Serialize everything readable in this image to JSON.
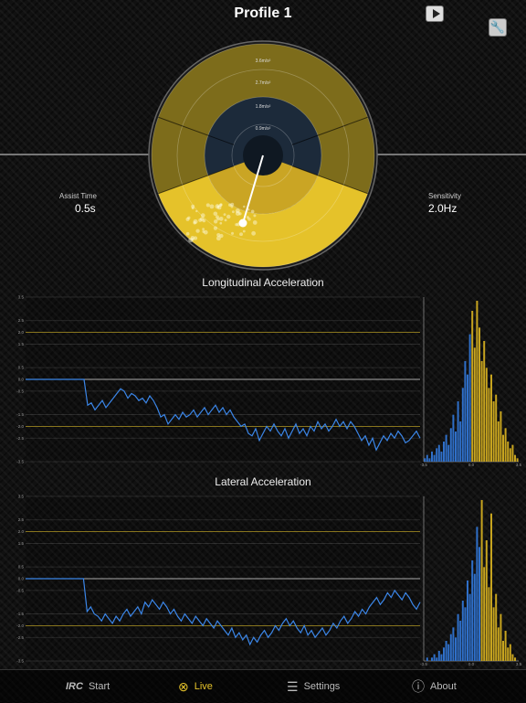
{
  "header": {
    "title": "Profile 1"
  },
  "radar": {
    "rings": [
      "3.6m/s²",
      "2.7m/s²",
      "1.8m/s²",
      "0.9m/s²"
    ]
  },
  "assist": {
    "label": "Assist Time",
    "value": "0.5s"
  },
  "sensitivity": {
    "label": "Sensitivity",
    "value": "2.0Hz"
  },
  "charts": [
    {
      "title": "Longitudinal Acceleration",
      "yticks": [
        "3.5",
        "2.5",
        "2.0",
        "1.5",
        "0.5",
        "0.0",
        "-0.5",
        "-1.5",
        "-2.0",
        "-2.5",
        "-3.5"
      ],
      "hist_ticks": [
        "-3.5",
        "0.0",
        "3.5"
      ]
    },
    {
      "title": "Lateral Acceleration",
      "yticks": [
        "3.5",
        "2.5",
        "2.0",
        "1.5",
        "0.5",
        "0.0",
        "-0.5",
        "-1.5",
        "-2.0",
        "-2.5",
        "-3.5"
      ],
      "hist_ticks": [
        "-3.5",
        "0.0",
        "3.5"
      ]
    }
  ],
  "chart_data": [
    {
      "type": "line",
      "title": "Longitudinal Acceleration",
      "ylim": [
        -3.5,
        3.5
      ],
      "threshold_lines": [
        2.0,
        -2.0
      ],
      "values": [
        0,
        0,
        0,
        0,
        0,
        0,
        0,
        0,
        0,
        0,
        0,
        0,
        0,
        0,
        0,
        0,
        0,
        -1.1,
        -1.0,
        -1.3,
        -1.1,
        -0.9,
        -1.2,
        -1.0,
        -0.8,
        -0.6,
        -0.4,
        -0.5,
        -0.8,
        -0.6,
        -0.7,
        -0.9,
        -0.8,
        -1.0,
        -0.7,
        -0.9,
        -1.2,
        -1.6,
        -1.5,
        -1.9,
        -1.7,
        -1.5,
        -1.7,
        -1.4,
        -1.6,
        -1.5,
        -1.3,
        -1.6,
        -1.4,
        -1.2,
        -1.5,
        -1.3,
        -1.1,
        -1.4,
        -1.2,
        -1.5,
        -1.3,
        -1.6,
        -1.8,
        -2.0,
        -1.9,
        -2.3,
        -2.4,
        -2.1,
        -2.6,
        -2.3,
        -2.0,
        -2.2,
        -1.9,
        -2.2,
        -2.4,
        -2.1,
        -2.5,
        -2.2,
        -1.9,
        -2.3,
        -2.1,
        -2.4,
        -2.0,
        -2.2,
        -1.8,
        -2.1,
        -1.9,
        -2.2,
        -2.0,
        -1.7,
        -2.0,
        -1.8,
        -2.1,
        -1.8,
        -2.0,
        -2.3,
        -2.6,
        -2.4,
        -2.8,
        -2.5,
        -3.0,
        -2.7,
        -2.4,
        -2.6,
        -2.3,
        -2.5,
        -2.2,
        -2.4,
        -2.7,
        -2.6,
        -2.4,
        -2.2,
        -2.5
      ],
      "histogram": {
        "bins": [
          1,
          2,
          1,
          3,
          2,
          4,
          5,
          3,
          6,
          8,
          5,
          10,
          14,
          9,
          18,
          12,
          22,
          30,
          26,
          38,
          45,
          34,
          48,
          40,
          30,
          36,
          28,
          22,
          26,
          18,
          20,
          12,
          15,
          8,
          10,
          6,
          4,
          5,
          2,
          1
        ],
        "highlight_from": 20
      }
    },
    {
      "type": "line",
      "title": "Lateral Acceleration",
      "ylim": [
        -3.5,
        3.5
      ],
      "threshold_lines": [
        2.0,
        -2.0
      ],
      "values": [
        0,
        0,
        0,
        0,
        0,
        0,
        0,
        0,
        0,
        0,
        0,
        0,
        0,
        0,
        0,
        0,
        0,
        -1.4,
        -1.2,
        -1.5,
        -1.6,
        -1.8,
        -1.5,
        -1.7,
        -1.9,
        -1.6,
        -1.8,
        -1.5,
        -1.3,
        -1.6,
        -1.4,
        -1.2,
        -1.5,
        -1.0,
        -1.2,
        -0.9,
        -1.1,
        -1.3,
        -1.0,
        -1.2,
        -1.5,
        -1.3,
        -1.6,
        -1.8,
        -1.5,
        -1.7,
        -1.9,
        -1.6,
        -1.8,
        -2.0,
        -1.7,
        -1.9,
        -2.1,
        -1.8,
        -2.0,
        -2.2,
        -2.4,
        -2.1,
        -2.5,
        -2.3,
        -2.6,
        -2.4,
        -2.8,
        -2.5,
        -2.7,
        -2.4,
        -2.2,
        -2.5,
        -2.3,
        -2.0,
        -2.2,
        -1.9,
        -1.7,
        -2.0,
        -1.8,
        -2.1,
        -2.3,
        -2.0,
        -2.4,
        -2.2,
        -2.5,
        -2.3,
        -2.1,
        -2.4,
        -2.2,
        -1.9,
        -2.1,
        -1.8,
        -1.6,
        -1.9,
        -1.7,
        -1.4,
        -1.6,
        -1.3,
        -1.5,
        -1.2,
        -1.0,
        -0.8,
        -1.1,
        -0.9,
        -0.6,
        -0.8,
        -0.5,
        -0.7,
        -0.9,
        -0.6,
        -0.8,
        -1.1,
        -1.3,
        -1.0
      ],
      "histogram": {
        "bins": [
          0,
          1,
          0,
          1,
          2,
          1,
          3,
          2,
          4,
          6,
          5,
          8,
          10,
          7,
          14,
          12,
          18,
          16,
          24,
          20,
          30,
          26,
          40,
          34,
          48,
          28,
          36,
          22,
          44,
          16,
          20,
          10,
          14,
          6,
          9,
          4,
          5,
          2,
          1,
          0
        ],
        "highlight_from": 24
      }
    }
  ],
  "tabbar": {
    "items": [
      {
        "label": "Start",
        "icon": "irc-logo-icon"
      },
      {
        "label": "Live",
        "icon": "live-target-icon"
      },
      {
        "label": "Settings",
        "icon": "settings-list-icon"
      },
      {
        "label": "About",
        "icon": "info-icon"
      }
    ]
  },
  "colors": {
    "accent": "#e5c22a",
    "line": "#3b86e8",
    "panel": "#1c2a3a",
    "radar_yellow": "#7d6c1b"
  }
}
